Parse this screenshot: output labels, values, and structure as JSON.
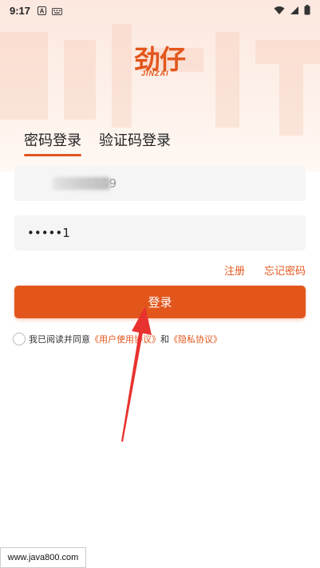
{
  "status_bar": {
    "time": "9:17",
    "left_icons": [
      "a-badge-icon",
      "keyboard-icon"
    ],
    "right_icons": [
      "wifi-icon",
      "signal-icon",
      "battery-icon"
    ]
  },
  "logo": {
    "main": "劲仔",
    "sub": "JINZAI"
  },
  "tabs": [
    {
      "label": "密码登录",
      "active": true
    },
    {
      "label": "验证码登录",
      "active": false
    }
  ],
  "form": {
    "phone_value": "1359",
    "password_value": "•••••1"
  },
  "links": {
    "register": "注册",
    "forgot_password": "忘记密码"
  },
  "login_button": "登录",
  "agreement": {
    "prefix": "我已阅读并同意",
    "user_agreement": "《用户使用协议》",
    "conjunction": "和",
    "privacy": "《隐私协议》"
  },
  "watermark": "www.java800.com",
  "colors": {
    "accent": "#e2561c",
    "annotation_arrow": "#e8322f"
  }
}
